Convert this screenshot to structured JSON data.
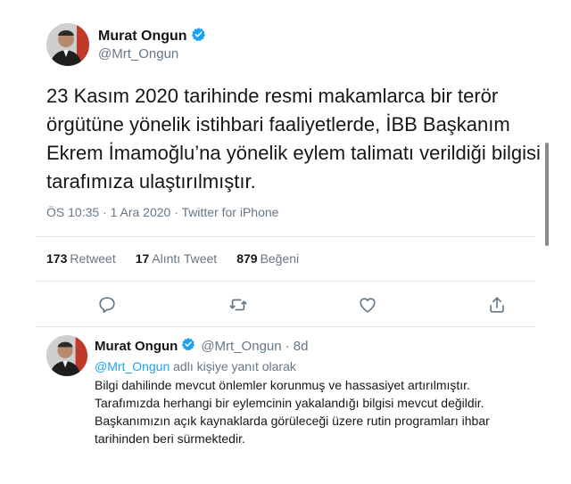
{
  "main_tweet": {
    "author_name": "Murat Ongun",
    "author_handle": "@Mrt_Ongun",
    "text": "23 Kasım 2020 tarihinde resmi makamlarca bir terör örgütüne yönelik istihbari faaliyetlerde, İBB Başkanım Ekrem İmamoğlu’na yönelik eylem talimatı verildiği bilgisi tarafımıza ulaştırılmıştır.",
    "meta": "ÖS 10:35 · 1 Ara 2020 · Twitter for iPhone",
    "stats": {
      "retweets_count": "173",
      "retweets_label": "Retweet",
      "quotes_count": "17",
      "quotes_label": "Alıntı Tweet",
      "likes_count": "879",
      "likes_label": "Beğeni"
    }
  },
  "actions": [
    "reply-icon",
    "retweet-icon",
    "like-icon",
    "share-icon"
  ],
  "reply_tweet": {
    "author_name": "Murat Ongun",
    "author_handle": "@Mrt_Ongun",
    "time": "· 8d",
    "replying_handle": "@Mrt_Ongun",
    "replying_suffix": " adlı kişiye yanıt olarak",
    "text_line1": "Bilgi dahilinde mevcut önlemler korunmuş ve hassasiyet artırılmıştır.",
    "text_line2": "Tarafımızda herhangi bir eylemcinin yakalandığı bilgisi mevcut değildir.",
    "text_line3": "Başkanımızın açık kaynaklarda görüleceği üzere rutin programları ihbar",
    "text_line4": "tarihinden beri sürmektedir."
  },
  "colors": {
    "verified_blue": "#1da1f2",
    "link_blue": "#1da1f2",
    "secondary_text": "#657786"
  }
}
